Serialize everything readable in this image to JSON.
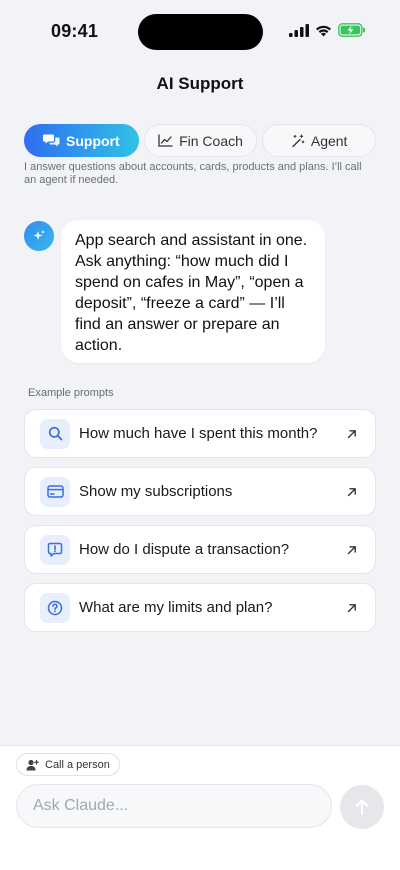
{
  "status_bar": {
    "time": "09:41"
  },
  "header": {
    "title": "AI Support"
  },
  "tabs": [
    {
      "label": "Support",
      "icon": "chat-bubbles-icon",
      "active": true
    },
    {
      "label": "Fin Coach",
      "icon": "trend-chart-icon",
      "active": false
    },
    {
      "label": "Agent",
      "icon": "magic-wand-icon",
      "active": false
    }
  ],
  "tab_description": "I answer questions about accounts, cards, products and plans. I’ll call an agent if needed.",
  "assistant_message": "App search and assistant in one. Ask anything: “how much did I spend on cafes in May”, “open a deposit”, “freeze a card” — I’ll find an answer or prepare an action.",
  "examples": {
    "label": "Example prompts",
    "items": [
      {
        "text": "How much have I spent this month?",
        "icon": "search-icon"
      },
      {
        "text": "Show my subscriptions",
        "icon": "credit-card-icon"
      },
      {
        "text": "How do I dispute a transaction?",
        "icon": "alert-message-icon"
      },
      {
        "text": "What are my limits and plan?",
        "icon": "help-circle-icon"
      }
    ]
  },
  "composer": {
    "call_person_label": "Call a person",
    "placeholder": "Ask Claude..."
  },
  "colors": {
    "accent_start": "#2f6ef0",
    "accent_end": "#30c2e6",
    "icon_blue": "#3a6fe0",
    "battery_green": "#34c759"
  }
}
